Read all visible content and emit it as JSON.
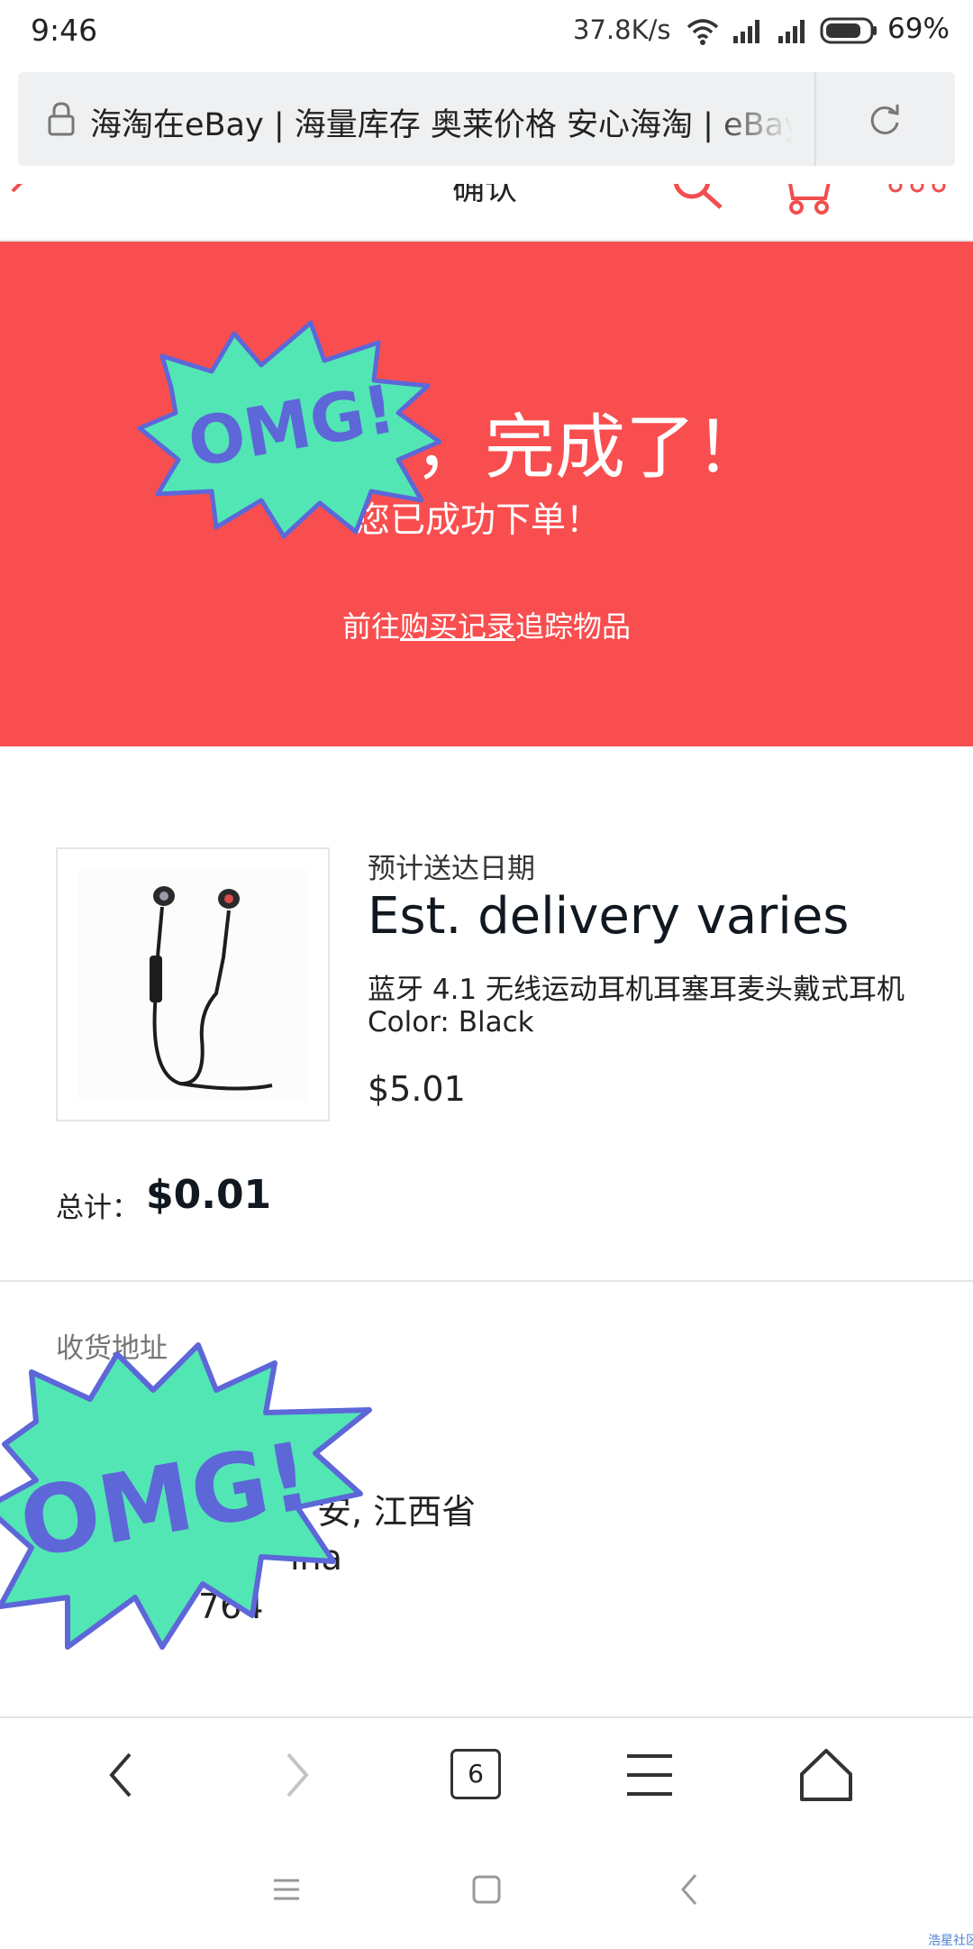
{
  "status_bar": {
    "time": "9:46",
    "net_speed": "37.8K/s",
    "battery": "69%"
  },
  "browser": {
    "url_title": "海淘在eBay | 海量库存 奥莱价格 安心海淘 | eBay",
    "tab_count": "6"
  },
  "header": {
    "title": "确认"
  },
  "hero": {
    "title": "，完成了！",
    "subtitle": "您已成功下单！",
    "link_prefix": "前往",
    "link_text": "购买记录",
    "link_suffix": "追踪物品",
    "background": "#f94e4f"
  },
  "order": {
    "delivery_label": "预计送达日期",
    "delivery_value": "Est. delivery varies",
    "item_title": "蓝牙 4.1 无线运动耳机耳塞耳麦头戴式耳机",
    "item_color": "Color: Black",
    "item_price": "$5.01",
    "total_label": "总计：",
    "total_value": "$0.01"
  },
  "address": {
    "label": "收货地址",
    "line_city": "安, 江西省",
    "line_country": "ina",
    "line_phone": "764"
  },
  "stickers": {
    "text": "OMG!",
    "fill": "#52e6b4",
    "text_color": "#5d67d8"
  },
  "watermark": "浩星社区",
  "icons": [
    "lock-icon",
    "reload-icon",
    "back-icon",
    "search-icon",
    "cart-icon",
    "menu-icon",
    "forward-icon",
    "hamburger-icon",
    "home-icon"
  ]
}
